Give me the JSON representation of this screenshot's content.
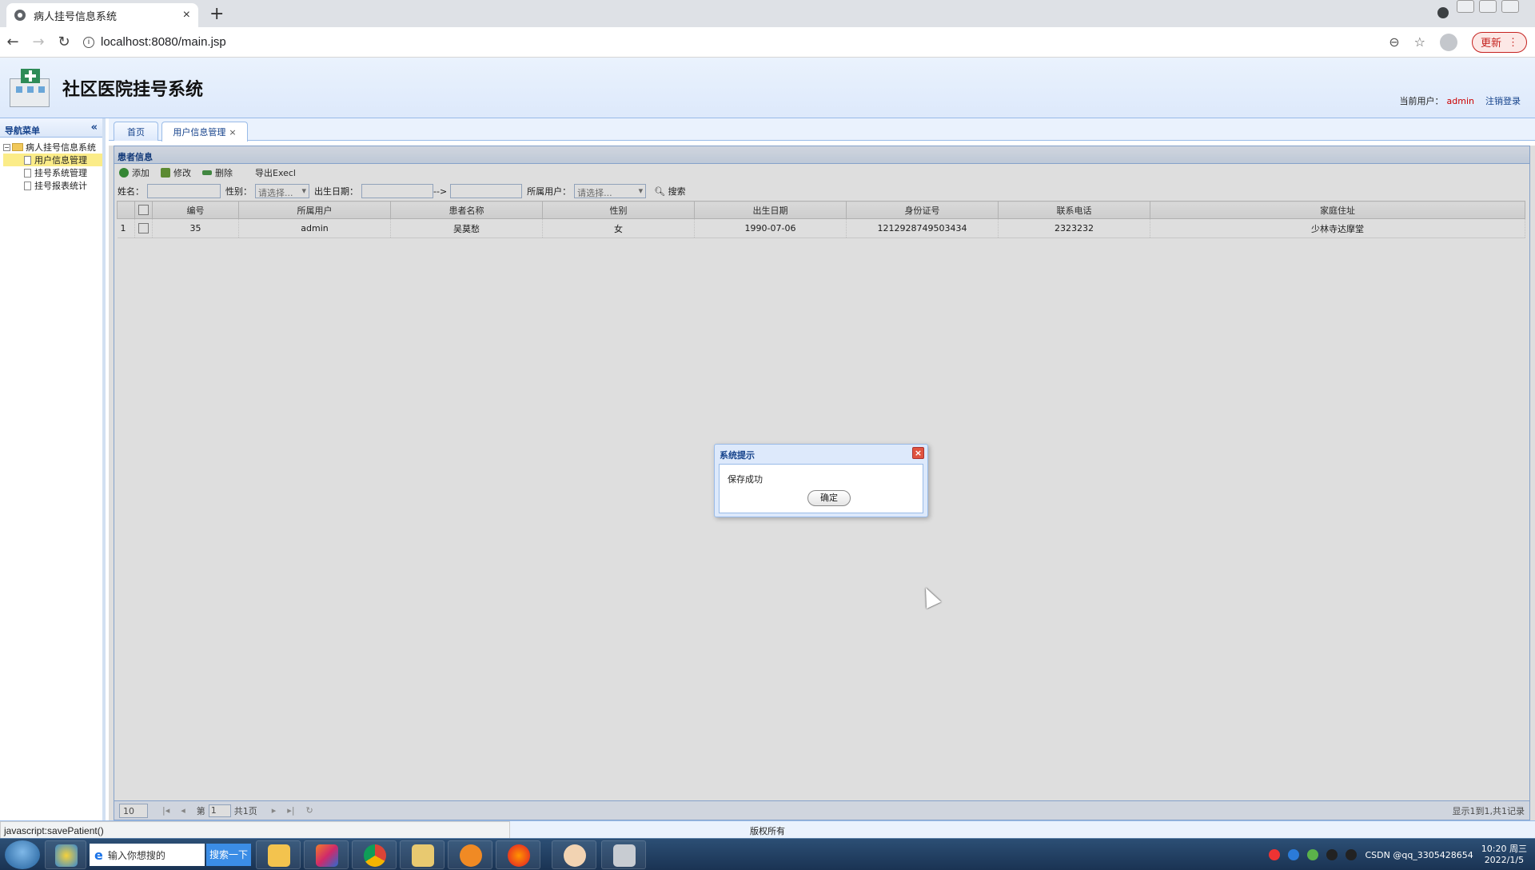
{
  "browser": {
    "tab_title": "病人挂号信息系统",
    "url": "localhost:8080/main.jsp",
    "update_label": "更新"
  },
  "app": {
    "title": "社区医院挂号系统",
    "current_user_label": "当前用户：",
    "current_user": "admin",
    "logout_label": "注销登录"
  },
  "nav": {
    "header": "导航菜单",
    "collapse_glyph": "«",
    "root": "病人挂号信息系统",
    "items": [
      {
        "label": "用户信息管理",
        "selected": true
      },
      {
        "label": "挂号系统管理",
        "selected": false
      },
      {
        "label": "挂号报表统计",
        "selected": false
      }
    ]
  },
  "tabs": [
    {
      "label": "首页"
    },
    {
      "label": "用户信息管理",
      "close": "×"
    }
  ],
  "panel": {
    "title": "患者信息",
    "toolbar": {
      "add": "添加",
      "edit": "修改",
      "delete": "删除",
      "export": "导出Execl"
    },
    "filters": {
      "name_label": "姓名：",
      "gender_label": "性别：",
      "gender_placeholder": "请选择...",
      "birth_label": "出生日期：",
      "range_sep": "-->",
      "owner_label": "所属用户：",
      "owner_placeholder": "请选择...",
      "search_label": "搜索"
    },
    "columns": [
      "编号",
      "所属用户",
      "患者名称",
      "性别",
      "出生日期",
      "身份证号",
      "联系电话",
      "家庭住址"
    ],
    "rows": [
      {
        "idx": "1",
        "id": "35",
        "owner": "admin",
        "name": "吴莫愁",
        "gender": "女",
        "birth": "1990-07-06",
        "idcard": "1212928749503434",
        "phone": "2323232",
        "address": "少林寺达摩堂"
      }
    ],
    "pager": {
      "page_size": "10",
      "page_label": "第",
      "page_value": "1",
      "total_pages": "共1页",
      "summary": "显示1到1,共1记录"
    }
  },
  "dialog": {
    "title": "系统提示",
    "message": "保存成功",
    "ok_label": "确定",
    "close_glyph": "×"
  },
  "status": {
    "link_status": "javascript:savePatient()",
    "copyright": "版权所有"
  },
  "taskbar": {
    "search_placeholder": "输入你想搜的",
    "search_button": "搜索一下",
    "tray_text": "CSDN @qq_3305428654",
    "time": "10:20 周三",
    "date": "2022/1/5"
  }
}
